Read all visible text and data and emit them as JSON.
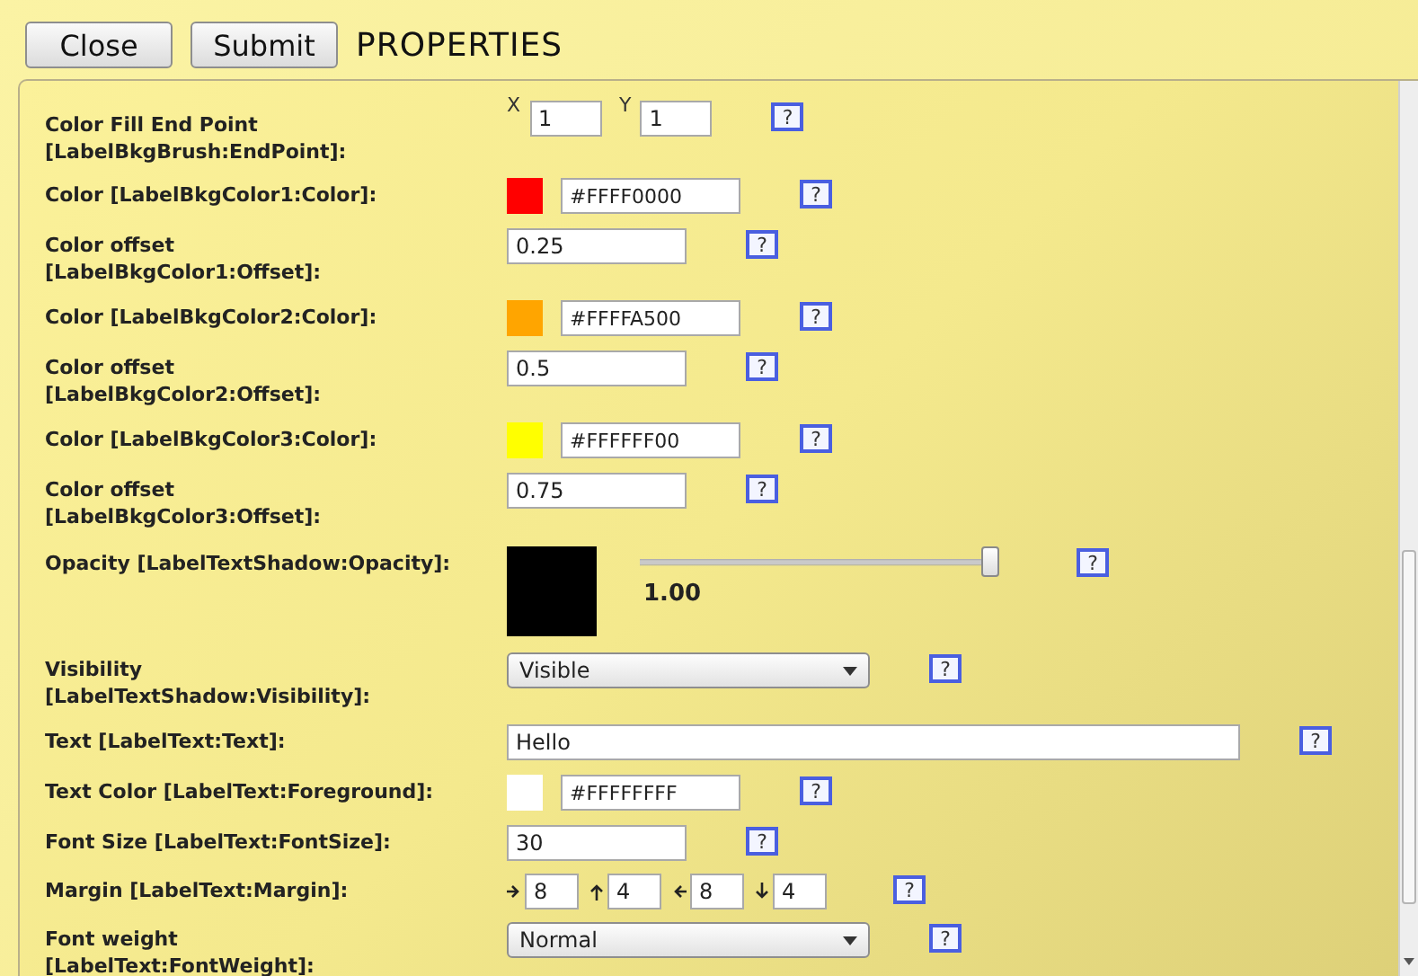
{
  "toolbar": {
    "buttons": [
      "Close",
      "Submit"
    ],
    "title": "PROPERTIES"
  },
  "rows": [
    {
      "kind": "point",
      "label_lines": [
        "Color Fill End Point",
        "[LabelBkgBrush:EndPoint]:"
      ],
      "fields": [
        {
          "name": "X",
          "value": "1"
        },
        {
          "name": "Y",
          "value": "1"
        }
      ],
      "help": "?"
    },
    {
      "kind": "color",
      "label_lines": [
        "Color [LabelBkgColor1:Color]:"
      ],
      "color": "#ff0000",
      "value": "#FFFF0000",
      "help": "?"
    },
    {
      "kind": "text",
      "label_lines": [
        "Color offset",
        "[LabelBkgColor1:Offset]:"
      ],
      "value": "0.25",
      "help": "?"
    },
    {
      "kind": "color",
      "label_lines": [
        "Color [LabelBkgColor2:Color]:"
      ],
      "color": "#ffa500",
      "value": "#FFFFA500",
      "help": "?"
    },
    {
      "kind": "text",
      "label_lines": [
        "Color offset",
        "[LabelBkgColor2:Offset]:"
      ],
      "value": "0.5",
      "help": "?"
    },
    {
      "kind": "color",
      "label_lines": [
        "Color [LabelBkgColor3:Color]:"
      ],
      "color": "#ffff00",
      "value": "#FFFFFF00",
      "help": "?"
    },
    {
      "kind": "text",
      "label_lines": [
        "Color offset",
        "[LabelBkgColor3:Offset]:"
      ],
      "value": "0.75",
      "help": "?"
    },
    {
      "kind": "opacity",
      "label_lines": [
        "Opacity [LabelTextShadow:Opacity]:"
      ],
      "color": "#000000",
      "level": 1,
      "reading": "1.00",
      "help": "?"
    },
    {
      "kind": "select",
      "label_lines": [
        "Visibility",
        "[LabelTextShadow:Visibility]:"
      ],
      "value": "Visible",
      "help": "?"
    },
    {
      "kind": "wide",
      "label_lines": [
        "Text [LabelText:Text]:"
      ],
      "value": "Hello",
      "help": "?"
    },
    {
      "kind": "color",
      "label_lines": [
        "Text Color [LabelText:Foreground]:"
      ],
      "color": "#ffffff",
      "value": "#FFFFFFFF",
      "help": "?"
    },
    {
      "kind": "text",
      "label_lines": [
        "Font Size [LabelText:FontSize]:"
      ],
      "value": "30",
      "help": "?"
    },
    {
      "kind": "margin",
      "label_lines": [
        "Margin [LabelText:Margin]:"
      ],
      "fields": [
        {
          "kind": "right",
          "value": "8"
        },
        {
          "kind": "up",
          "value": "4"
        },
        {
          "kind": "left",
          "value": "8"
        },
        {
          "kind": "down",
          "value": "4"
        }
      ],
      "help": "?"
    },
    {
      "kind": "select",
      "label_lines": [
        "Font weight",
        "[LabelText:FontWeight]:"
      ],
      "value": "Normal",
      "help": "?"
    }
  ]
}
